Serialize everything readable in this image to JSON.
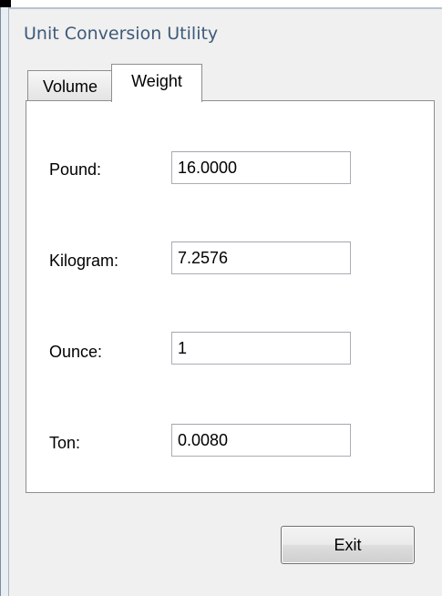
{
  "window": {
    "title": "Unit Conversion Utility"
  },
  "tabs": [
    {
      "label": "Volume",
      "selected": false
    },
    {
      "label": "Weight",
      "selected": true
    }
  ],
  "fields": {
    "pound": {
      "label": "Pound:",
      "value": "16.0000"
    },
    "kilogram": {
      "label": "Kilogram:",
      "value": "7.2576"
    },
    "ounce": {
      "label": "Ounce:",
      "value": "1"
    },
    "ton": {
      "label": "Ton:",
      "value": "0.0080"
    }
  },
  "buttons": {
    "exit_label": "Exit"
  },
  "colors": {
    "title_text": "#3e5a7a",
    "client_background": "#f0f0f0",
    "panel_background": "#ffffff",
    "border": "#8e8f8f"
  }
}
